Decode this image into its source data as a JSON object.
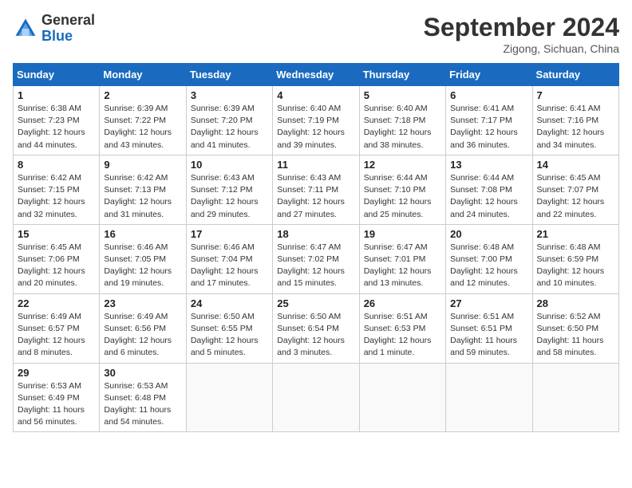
{
  "header": {
    "logo_general": "General",
    "logo_blue": "Blue",
    "month_title": "September 2024",
    "subtitle": "Zigong, Sichuan, China"
  },
  "weekdays": [
    "Sunday",
    "Monday",
    "Tuesday",
    "Wednesday",
    "Thursday",
    "Friday",
    "Saturday"
  ],
  "weeks": [
    [
      {
        "day": "1",
        "sunrise": "6:38 AM",
        "sunset": "7:23 PM",
        "daylight": "12 hours and 44 minutes."
      },
      {
        "day": "2",
        "sunrise": "6:39 AM",
        "sunset": "7:22 PM",
        "daylight": "12 hours and 43 minutes."
      },
      {
        "day": "3",
        "sunrise": "6:39 AM",
        "sunset": "7:20 PM",
        "daylight": "12 hours and 41 minutes."
      },
      {
        "day": "4",
        "sunrise": "6:40 AM",
        "sunset": "7:19 PM",
        "daylight": "12 hours and 39 minutes."
      },
      {
        "day": "5",
        "sunrise": "6:40 AM",
        "sunset": "7:18 PM",
        "daylight": "12 hours and 38 minutes."
      },
      {
        "day": "6",
        "sunrise": "6:41 AM",
        "sunset": "7:17 PM",
        "daylight": "12 hours and 36 minutes."
      },
      {
        "day": "7",
        "sunrise": "6:41 AM",
        "sunset": "7:16 PM",
        "daylight": "12 hours and 34 minutes."
      }
    ],
    [
      {
        "day": "8",
        "sunrise": "6:42 AM",
        "sunset": "7:15 PM",
        "daylight": "12 hours and 32 minutes."
      },
      {
        "day": "9",
        "sunrise": "6:42 AM",
        "sunset": "7:13 PM",
        "daylight": "12 hours and 31 minutes."
      },
      {
        "day": "10",
        "sunrise": "6:43 AM",
        "sunset": "7:12 PM",
        "daylight": "12 hours and 29 minutes."
      },
      {
        "day": "11",
        "sunrise": "6:43 AM",
        "sunset": "7:11 PM",
        "daylight": "12 hours and 27 minutes."
      },
      {
        "day": "12",
        "sunrise": "6:44 AM",
        "sunset": "7:10 PM",
        "daylight": "12 hours and 25 minutes."
      },
      {
        "day": "13",
        "sunrise": "6:44 AM",
        "sunset": "7:08 PM",
        "daylight": "12 hours and 24 minutes."
      },
      {
        "day": "14",
        "sunrise": "6:45 AM",
        "sunset": "7:07 PM",
        "daylight": "12 hours and 22 minutes."
      }
    ],
    [
      {
        "day": "15",
        "sunrise": "6:45 AM",
        "sunset": "7:06 PM",
        "daylight": "12 hours and 20 minutes."
      },
      {
        "day": "16",
        "sunrise": "6:46 AM",
        "sunset": "7:05 PM",
        "daylight": "12 hours and 19 minutes."
      },
      {
        "day": "17",
        "sunrise": "6:46 AM",
        "sunset": "7:04 PM",
        "daylight": "12 hours and 17 minutes."
      },
      {
        "day": "18",
        "sunrise": "6:47 AM",
        "sunset": "7:02 PM",
        "daylight": "12 hours and 15 minutes."
      },
      {
        "day": "19",
        "sunrise": "6:47 AM",
        "sunset": "7:01 PM",
        "daylight": "12 hours and 13 minutes."
      },
      {
        "day": "20",
        "sunrise": "6:48 AM",
        "sunset": "7:00 PM",
        "daylight": "12 hours and 12 minutes."
      },
      {
        "day": "21",
        "sunrise": "6:48 AM",
        "sunset": "6:59 PM",
        "daylight": "12 hours and 10 minutes."
      }
    ],
    [
      {
        "day": "22",
        "sunrise": "6:49 AM",
        "sunset": "6:57 PM",
        "daylight": "12 hours and 8 minutes."
      },
      {
        "day": "23",
        "sunrise": "6:49 AM",
        "sunset": "6:56 PM",
        "daylight": "12 hours and 6 minutes."
      },
      {
        "day": "24",
        "sunrise": "6:50 AM",
        "sunset": "6:55 PM",
        "daylight": "12 hours and 5 minutes."
      },
      {
        "day": "25",
        "sunrise": "6:50 AM",
        "sunset": "6:54 PM",
        "daylight": "12 hours and 3 minutes."
      },
      {
        "day": "26",
        "sunrise": "6:51 AM",
        "sunset": "6:53 PM",
        "daylight": "12 hours and 1 minute."
      },
      {
        "day": "27",
        "sunrise": "6:51 AM",
        "sunset": "6:51 PM",
        "daylight": "11 hours and 59 minutes."
      },
      {
        "day": "28",
        "sunrise": "6:52 AM",
        "sunset": "6:50 PM",
        "daylight": "11 hours and 58 minutes."
      }
    ],
    [
      {
        "day": "29",
        "sunrise": "6:53 AM",
        "sunset": "6:49 PM",
        "daylight": "11 hours and 56 minutes."
      },
      {
        "day": "30",
        "sunrise": "6:53 AM",
        "sunset": "6:48 PM",
        "daylight": "11 hours and 54 minutes."
      },
      null,
      null,
      null,
      null,
      null
    ]
  ]
}
